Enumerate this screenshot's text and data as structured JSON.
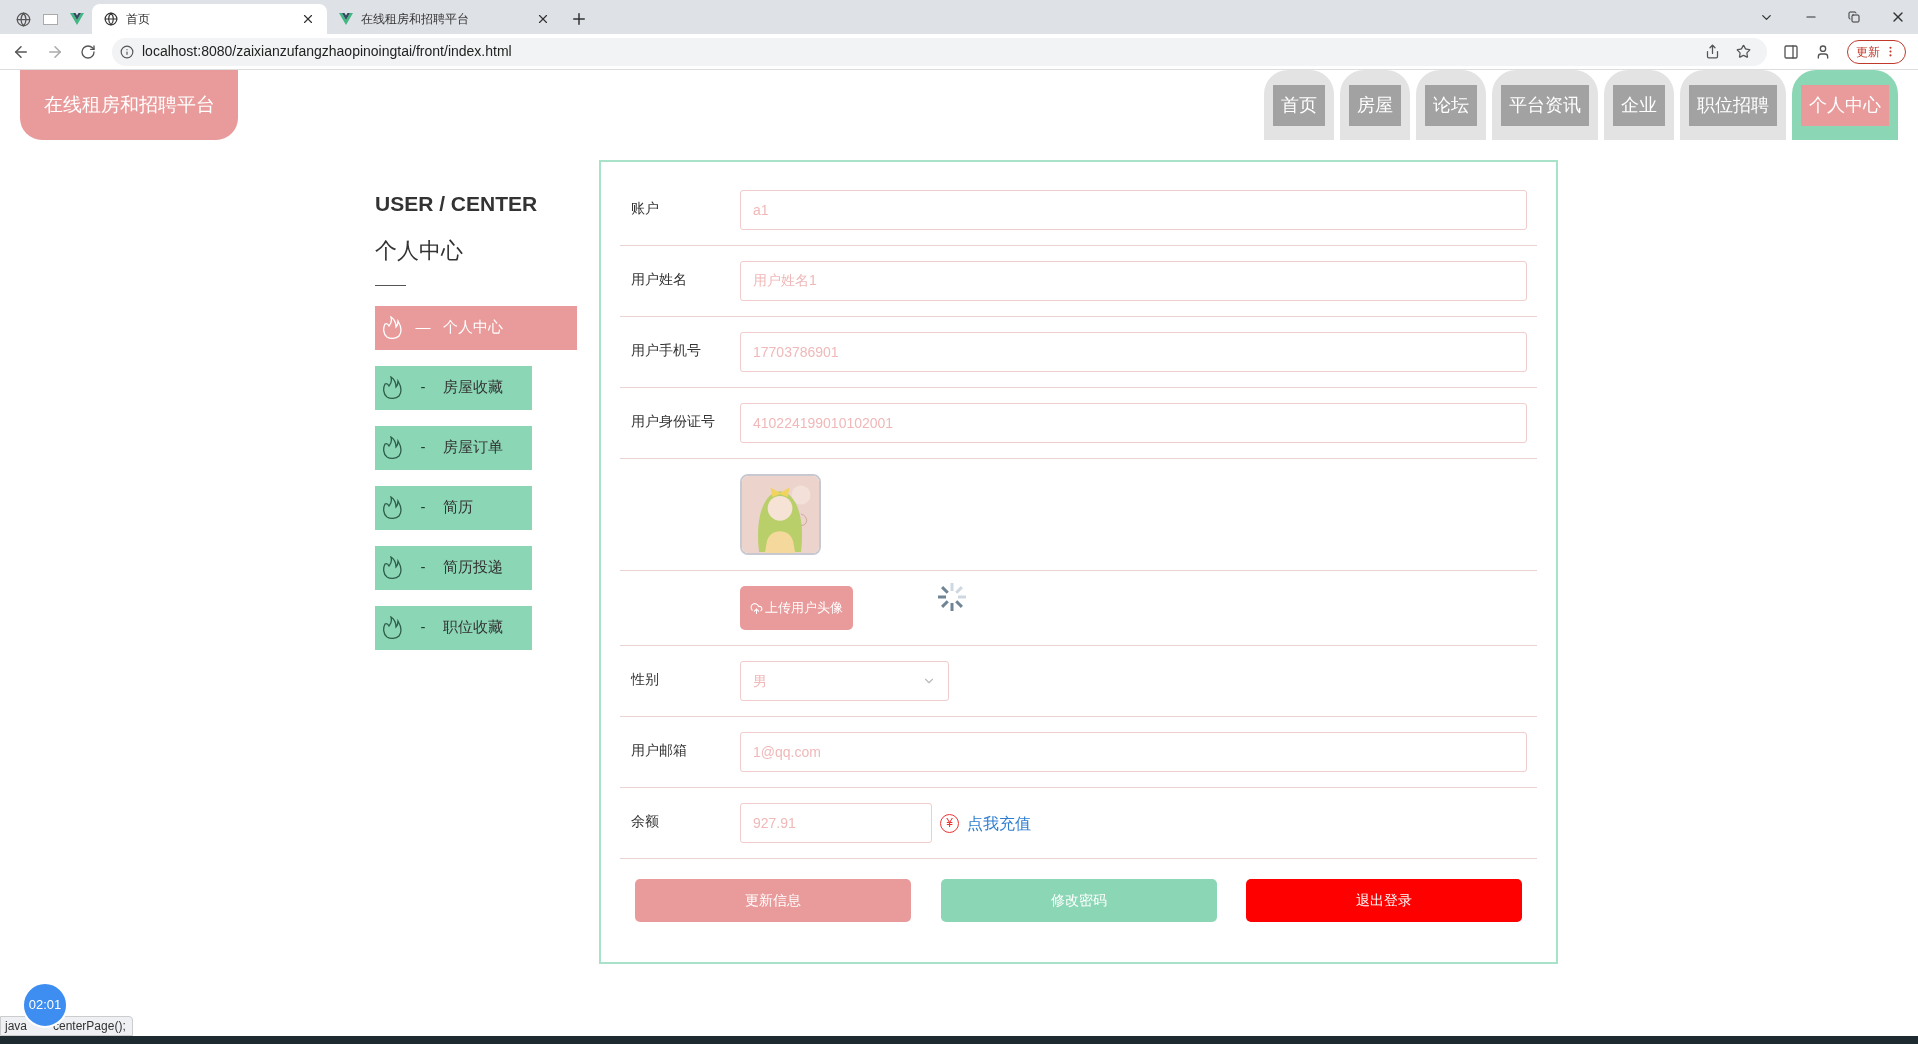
{
  "browser": {
    "tabs": [
      {
        "title": "首页",
        "selected": true
      },
      {
        "title": "在线租房和招聘平台",
        "selected": false
      }
    ],
    "url": "localhost:8080/zaixianzufangzhaopinoingtai/front/index.html",
    "update_button": "更新"
  },
  "header": {
    "logo": "在线租房和招聘平台",
    "nav": [
      {
        "label": "首页",
        "selected": false
      },
      {
        "label": "房屋",
        "selected": false
      },
      {
        "label": "论坛",
        "selected": false
      },
      {
        "label": "平台资讯",
        "selected": false
      },
      {
        "label": "企业",
        "selected": false
      },
      {
        "label": "职位招聘",
        "selected": false
      },
      {
        "label": "个人中心",
        "selected": true
      }
    ]
  },
  "sidebar": {
    "title_en": "USER / CENTER",
    "title": "个人中心",
    "items": [
      {
        "dash": "—",
        "label": "个人中心",
        "selected": true
      },
      {
        "dash": "-",
        "label": "房屋收藏",
        "selected": false
      },
      {
        "dash": "-",
        "label": "房屋订单",
        "selected": false
      },
      {
        "dash": "-",
        "label": "简历",
        "selected": false
      },
      {
        "dash": "-",
        "label": "简历投递",
        "selected": false
      },
      {
        "dash": "-",
        "label": "职位收藏",
        "selected": false
      }
    ]
  },
  "form": {
    "rows": [
      {
        "kind": "text",
        "label": "账户",
        "value": "a1"
      },
      {
        "kind": "text",
        "label": "用户姓名",
        "value": "用户姓名1"
      },
      {
        "kind": "text",
        "label": "用户手机号",
        "value": "17703786901"
      },
      {
        "kind": "text",
        "label": "用户身份证号",
        "value": "410224199010102001"
      },
      {
        "kind": "avatar"
      },
      {
        "kind": "upload",
        "button": "上传用户头像"
      },
      {
        "kind": "select",
        "label": "性别",
        "value": "男"
      },
      {
        "kind": "text",
        "label": "用户邮箱",
        "value": "1@qq.com"
      },
      {
        "kind": "balance",
        "label": "余额",
        "value": "927.91",
        "currency": "¥",
        "link": "点我充值"
      }
    ],
    "buttons": [
      {
        "label": "更新信息",
        "color": "#e99a9a"
      },
      {
        "label": "修改密码",
        "color": "#8bd6b5"
      },
      {
        "label": "退出登录",
        "color": "#ff0000"
      }
    ]
  },
  "timer": "02:01",
  "status_bar": [
    "java",
    "centerPage();"
  ]
}
